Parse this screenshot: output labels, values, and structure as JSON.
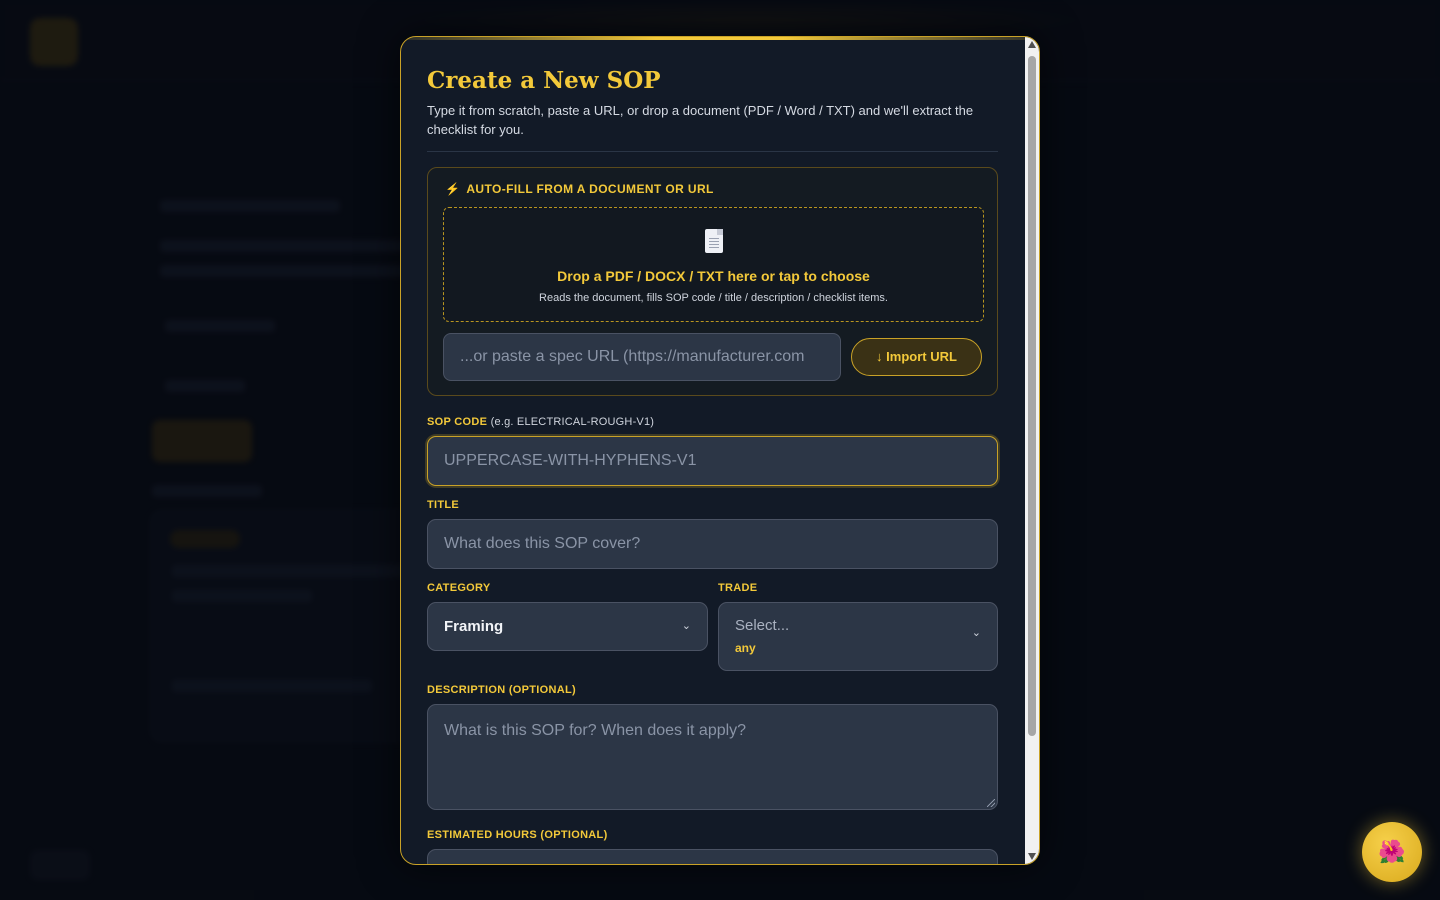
{
  "modal": {
    "title": "Create a New SOP",
    "subtitle": "Type it from scratch, paste a URL, or drop a document (PDF / Word / TXT) and we'll extract the checklist for you.",
    "autofill": {
      "heading": "AUTO-FILL FROM A DOCUMENT OR URL",
      "bolt_icon": "⚡",
      "drop_main": "Drop a PDF / DOCX / TXT here or tap to choose",
      "drop_sub": "Reads the document, fills SOP code / title / description / checklist items.",
      "url_placeholder": "...or paste a spec URL (https://manufacturer.com",
      "import_label": "↓ Import URL"
    },
    "sop_code": {
      "label": "SOP CODE",
      "hint": "(e.g. ELECTRICAL-ROUGH-V1)",
      "placeholder": "UPPERCASE-WITH-HYPHENS-V1"
    },
    "title_field": {
      "label": "TITLE",
      "placeholder": "What does this SOP cover?"
    },
    "category": {
      "label": "CATEGORY",
      "value": "Framing"
    },
    "trade": {
      "label": "TRADE",
      "placeholder": "Select...",
      "sub": "any"
    },
    "description": {
      "label": "DESCRIPTION (OPTIONAL)",
      "placeholder": "What is this SOP for? When does it apply?"
    },
    "hours": {
      "label": "ESTIMATED HOURS (OPTIONAL)"
    }
  },
  "fab_icon": "🌺",
  "colors": {
    "accent": "#f3c93a",
    "background": "#0b1019",
    "modal": "#121a27",
    "field": "#2c3646"
  }
}
